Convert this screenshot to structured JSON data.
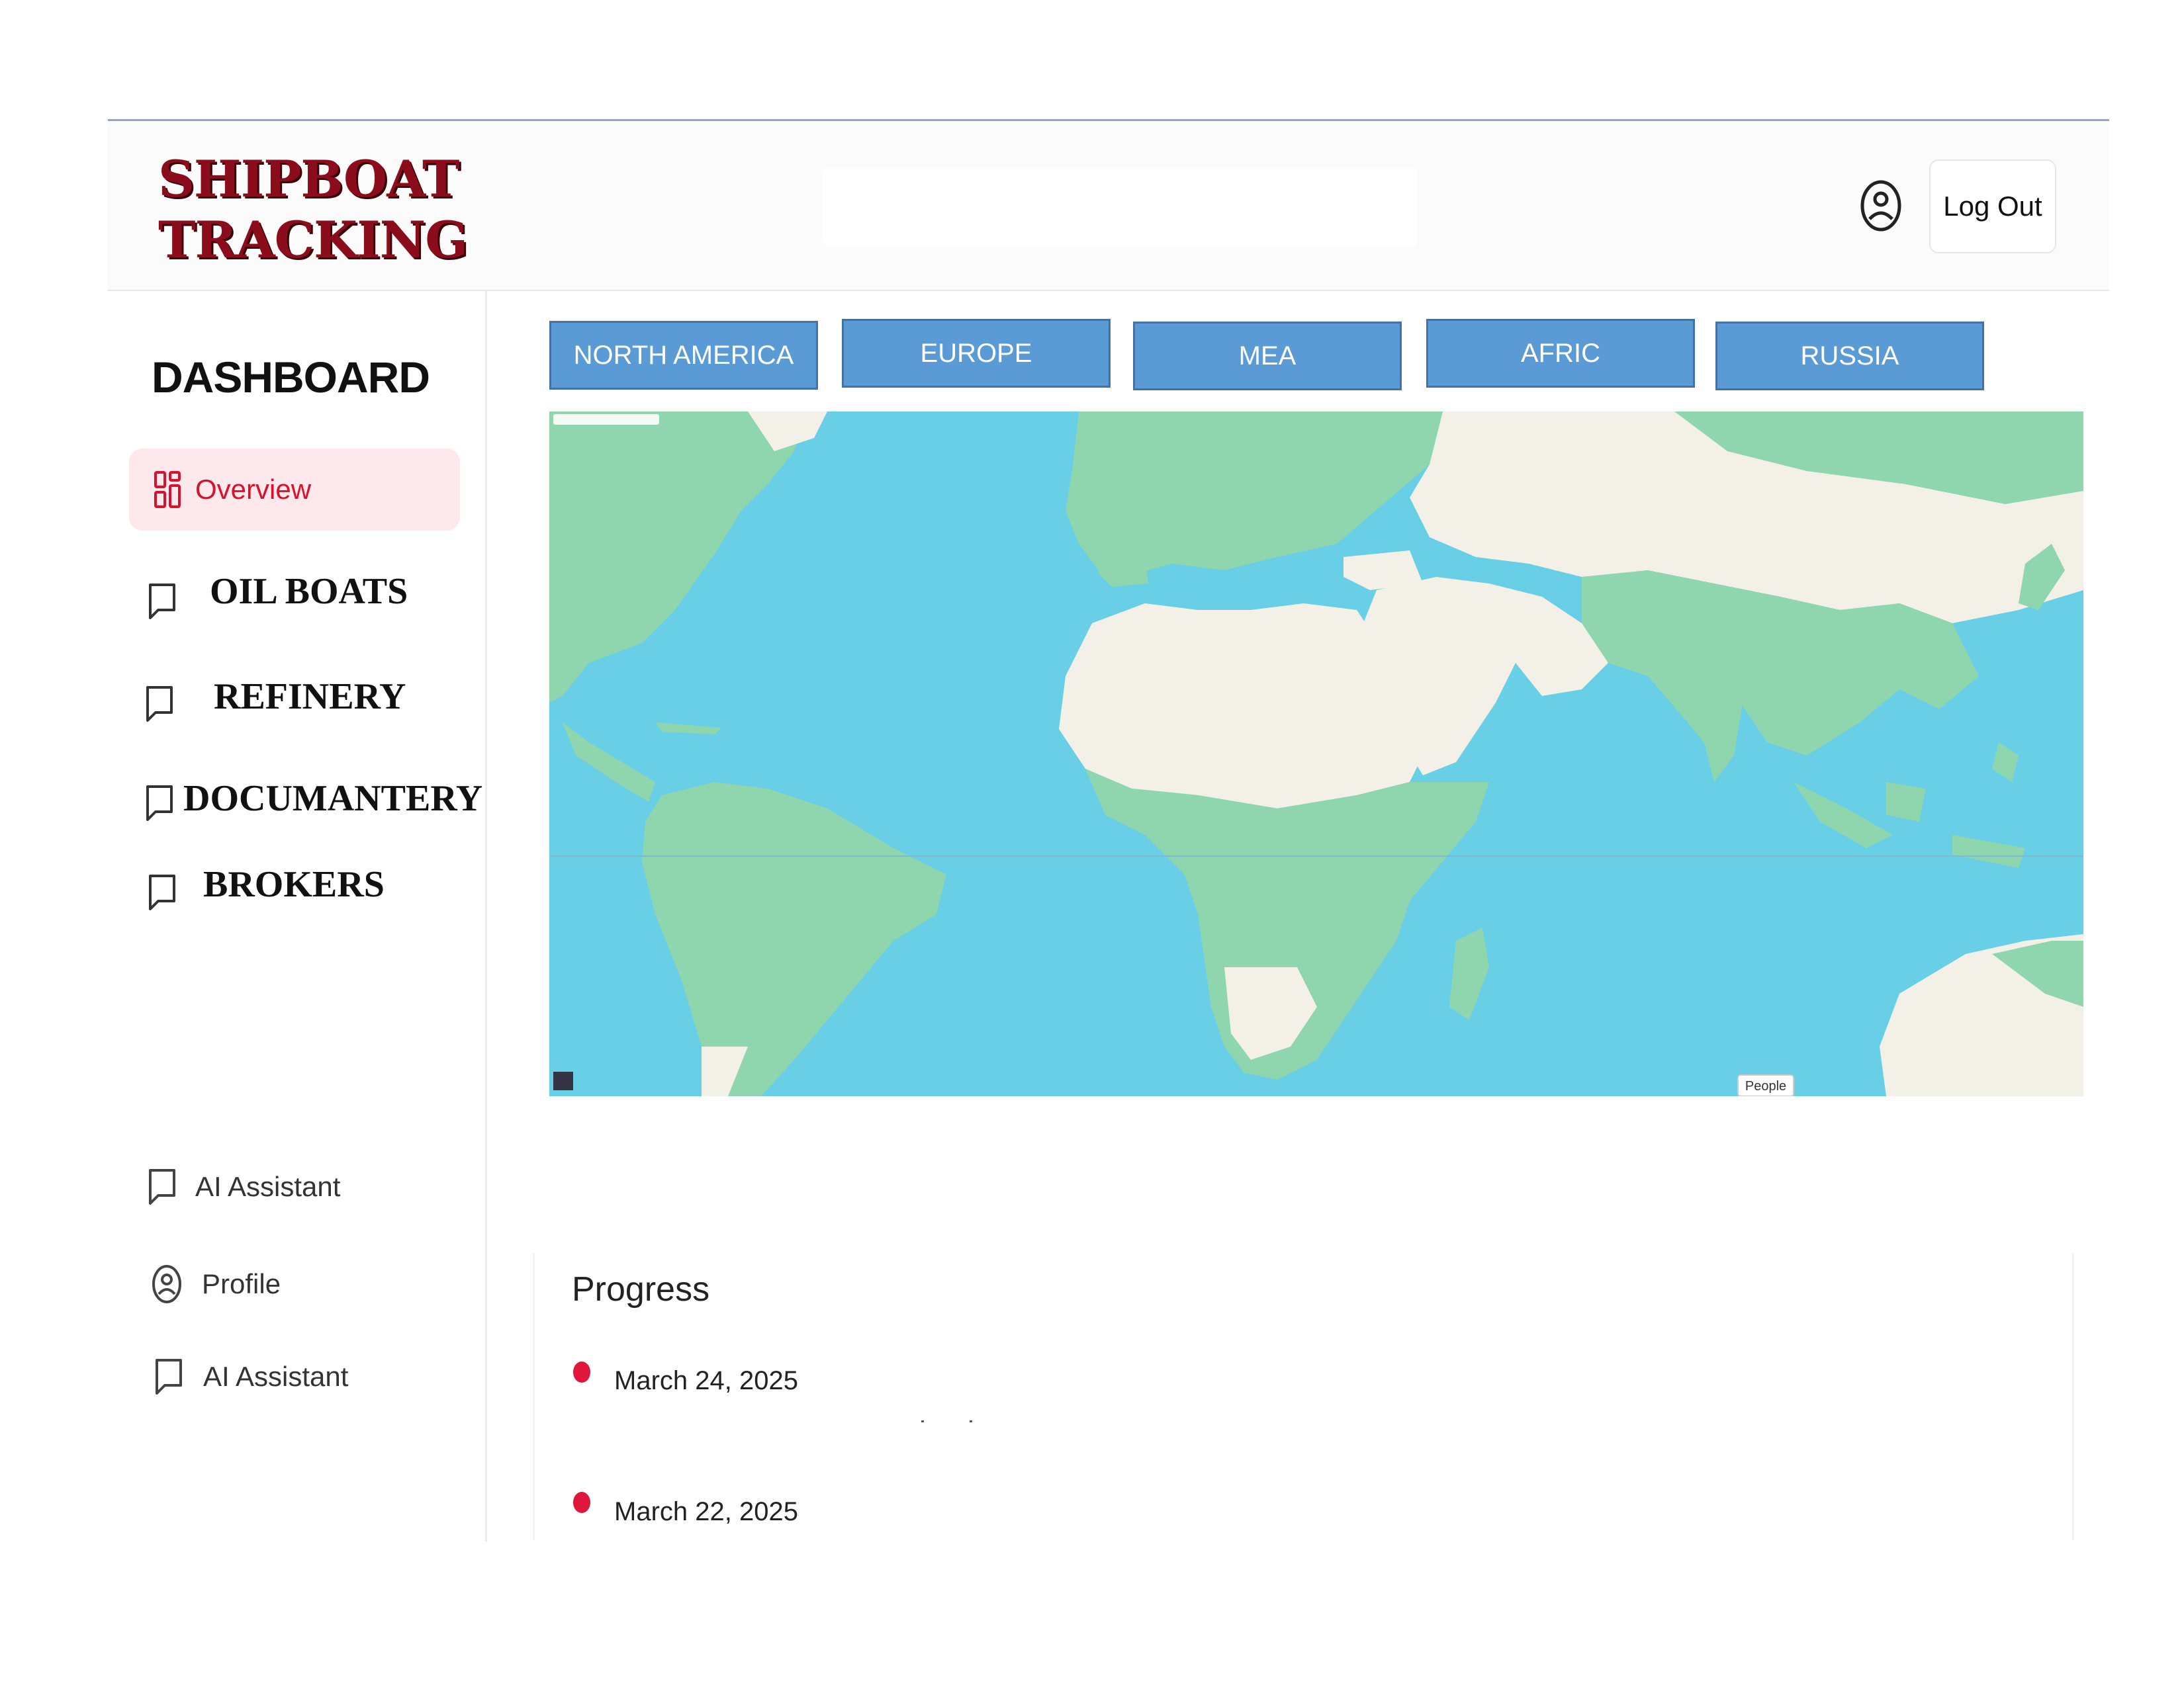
{
  "header": {
    "logo_line1": "SHIPBOAT",
    "logo_line2": "TRACKING",
    "logout_label": "Log Out"
  },
  "sidebar": {
    "title": "DASHBOARD",
    "overview_label": "Overview",
    "items": [
      {
        "label": "OIL BOATS"
      },
      {
        "label": "REFINERY"
      },
      {
        "label": "DOCUMANTERY"
      },
      {
        "label": "BROKERS"
      }
    ],
    "bottom_items": [
      {
        "label": "AI Assistant",
        "icon": "chat-icon"
      },
      {
        "label": "Profile",
        "icon": "user-icon"
      },
      {
        "label": "AI Assistant",
        "icon": "chat-icon"
      }
    ]
  },
  "regions": [
    "NORTH AMERICA",
    "EUROPE",
    "MEA",
    "AFRIC",
    "RUSSIA"
  ],
  "map": {
    "people_label": "People",
    "colors": {
      "ocean": "#68cfe6",
      "land_green": "#8fd5ae",
      "land_sand": "#f3f0e8"
    }
  },
  "progress": {
    "title": "Progress",
    "entries": [
      {
        "date": "March 24, 2025"
      },
      {
        "date": "March 22, 2025"
      }
    ]
  },
  "colors": {
    "accent": "#d8112f",
    "region_button": "#5b9bd5",
    "logo": "#8b0d1c"
  }
}
